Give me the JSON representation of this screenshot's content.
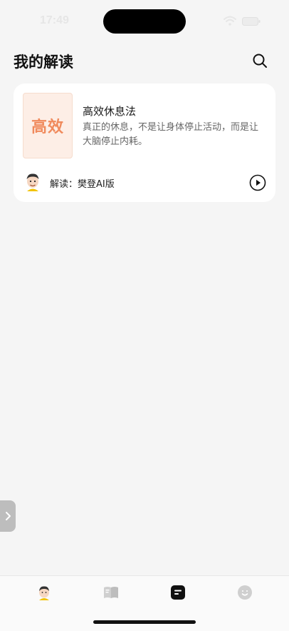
{
  "status_bar": {
    "time": "17:49"
  },
  "header": {
    "title": "我的解读"
  },
  "card": {
    "cover_text": "高效",
    "title": "高效休息法",
    "description": "真正的休息，不是让身体停止活动，而是让大脑停止内耗。",
    "author_line": "解读：樊登AI版"
  },
  "colors": {
    "background": "#f5f5f5",
    "card": "#ffffff",
    "cover_bg": "#fdeee6",
    "cover_text": "#f08a5c",
    "side_tab": "#bdbdbd"
  },
  "tabbar": {
    "tabs": [
      {
        "icon": "avatar-icon",
        "active": false
      },
      {
        "icon": "book-icon",
        "active": false
      },
      {
        "icon": "notes-icon",
        "active": true
      },
      {
        "icon": "smile-icon",
        "active": false
      }
    ]
  }
}
